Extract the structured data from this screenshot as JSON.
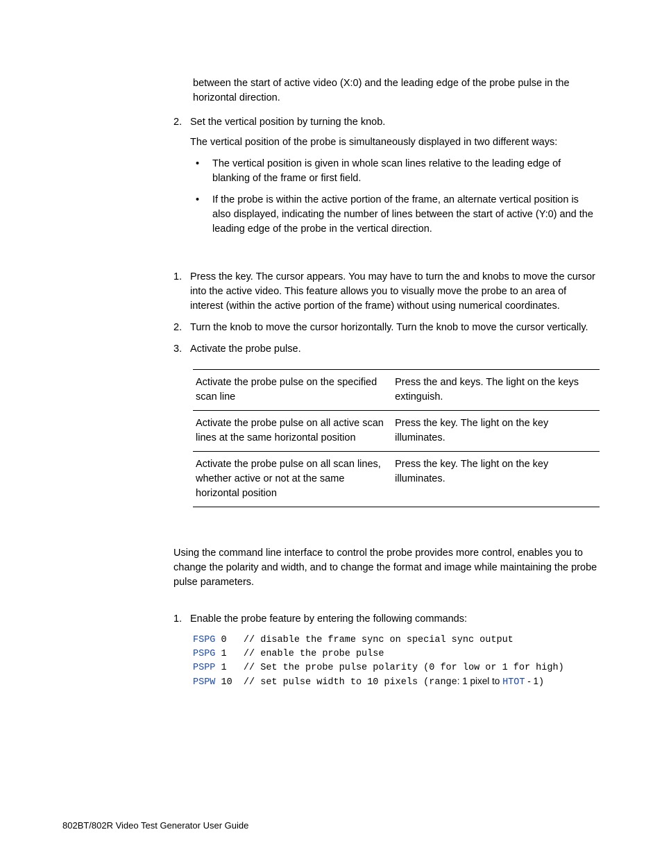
{
  "intro_para": "between the start of active video (X:0) and the leading edge of the probe pulse in the horizontal direction.",
  "step2": {
    "num": "2.",
    "lead": "Set the vertical position by turning the ",
    "mid": " knob.",
    "sub1": "The vertical position of the probe is simultaneously displayed in two different ways:",
    "b1a": "The vertical position ",
    "b1b": " is given in whole scan lines relative to the leading edge of blanking of the frame or first field.",
    "b2a": "If the probe is within the active portion of the frame, an alternate vertical position ",
    "b2b": " is also displayed, indicating the number of lines between the start of active (Y:0) and the leading edge of the probe in the vertical direction."
  },
  "proc2": {
    "s1": {
      "num": "1.",
      "t1": "Press the ",
      "t2": " key. The cursor appears. You may have to turn the ",
      "t3": " and ",
      "t4": " knobs to move the cursor into the active video. This feature allows you to visually move the probe to an area of interest (within the active portion of the frame) without using numerical coordinates."
    },
    "s2": {
      "num": "2.",
      "t1": "Turn the ",
      "t2": " knob to move the cursor horizontally. Turn the ",
      "t3": " knob to move the cursor vertically."
    },
    "s3": {
      "num": "3.",
      "t1": "Activate the probe pulse."
    }
  },
  "table": {
    "r1c1": "Activate the probe pulse on the specified scan line",
    "r1c2a": "Press the ",
    "r1c2b": " and ",
    "r1c2c": " keys. The light on the keys extinguish.",
    "r2c1": "Activate the probe pulse on all active scan lines at the same horizontal position",
    "r2c2a": "Press the ",
    "r2c2b": " key. The light on the key illuminates.",
    "r3c1": "Activate the probe pulse on all scan lines, whether active or not at the same horizontal position",
    "r3c2a": "Press the ",
    "r3c2b": " key. The light on the key illuminates."
  },
  "cli_para": "Using the command line interface to control the probe provides more control, enables you to change the polarity and width, and to change the format and image while maintaining the probe pulse parameters.",
  "cli_step1": {
    "num": "1.",
    "text": "Enable the probe feature by entering the following commands:"
  },
  "code": {
    "c1": "FSPG",
    "a1": " 0   // disable the frame sync on special sync output",
    "c2": "PSPG",
    "a2": " 1   // enable the probe pulse",
    "c3": "PSPP",
    "a3": " 1   // Set the probe pulse polarity (0 for low or 1 for high)",
    "c4": "PSPW",
    "a4a": " 10  // set pulse width to 10 pixels (range",
    "a4b": ": 1 pixel to ",
    "htot": "HTOT",
    "a4c": " - 1",
    "a4d": ")"
  },
  "footer": "802BT/802R Video Test Generator User Guide"
}
